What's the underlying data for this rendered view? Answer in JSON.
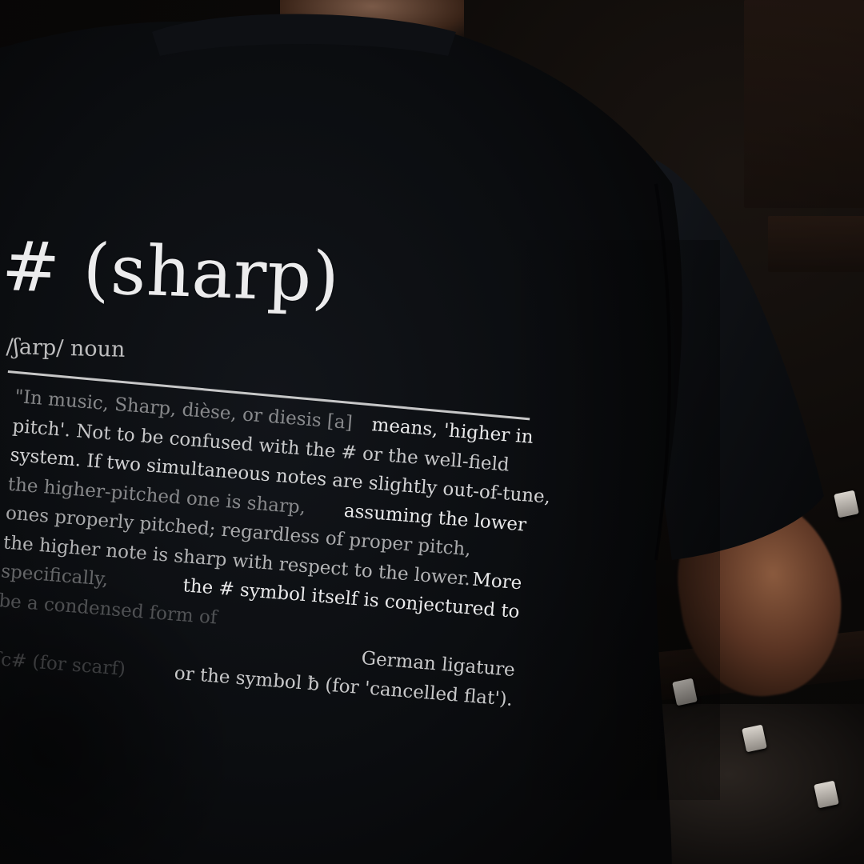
{
  "print": {
    "headword": "# (sharp)",
    "pronunciation": "/ʃarp/ noun",
    "lines": [
      {
        "left": "\"In music, Sharp, dièse, or diesis [a]",
        "right": "means, 'higher in"
      },
      {
        "left": "pitch'. Not to be confused with the # or the well-field",
        "right": ""
      },
      {
        "left": "system. If two simultaneous notes are slightly out-of-tune,",
        "right": ""
      },
      {
        "left": "the higher-pitched one is sharp,",
        "right": "assuming the lower"
      },
      {
        "left": "ones properly pitched; regardless of proper pitch,",
        "right": ""
      },
      {
        "left": "the higher note is sharp with respect to the lower.",
        "right": "More"
      },
      {
        "left": "specifically,",
        "right": "the #  symbol itself is conjectured to"
      },
      {
        "left": "be a condensed form of",
        "right": ""
      },
      {
        "left": "",
        "right": "German ligature"
      },
      {
        "left": "ſc# (for scarf)",
        "right": "or the symbol ƀ (for 'cancelled flat')."
      }
    ]
  },
  "colors": {
    "shirt": "#0b0d10",
    "print": "#e9e9ea",
    "background": "#050506",
    "skin": "#6b4330"
  }
}
